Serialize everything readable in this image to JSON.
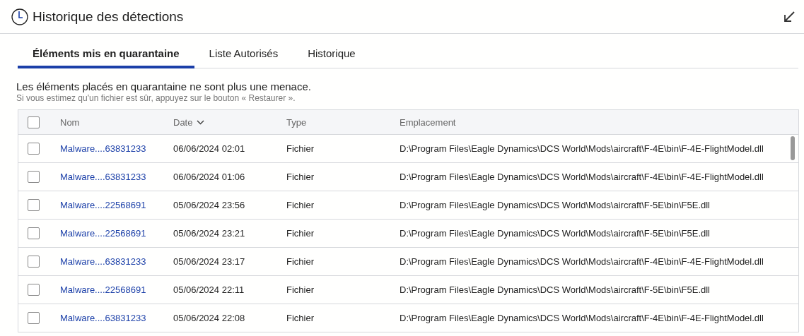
{
  "window": {
    "title": "Historique des détections"
  },
  "tabs": [
    {
      "label": "Éléments mis en quarantaine",
      "selected": true
    },
    {
      "label": "Liste Autorisés",
      "selected": false
    },
    {
      "label": "Historique",
      "selected": false
    }
  ],
  "description": "Les éléments placés en quarantaine ne sont plus une menace.",
  "hint": "Si vous estimez qu'un fichier est sûr, appuyez sur le bouton « Restaurer ».",
  "table": {
    "select_all_checked": false,
    "columns": [
      "Nom",
      "Date",
      "Type",
      "Emplacement"
    ],
    "rows": [
      {
        "checked": false,
        "name": "Malware....63831233",
        "date": "06/06/2024 02:01",
        "type": "Fichier",
        "location": "D:\\Program Files\\Eagle Dynamics\\DCS World\\Mods\\aircraft\\F-4E\\bin\\F-4E-FlightModel.dll"
      },
      {
        "checked": false,
        "name": "Malware....63831233",
        "date": "06/06/2024 01:06",
        "type": "Fichier",
        "location": "D:\\Program Files\\Eagle Dynamics\\DCS World\\Mods\\aircraft\\F-4E\\bin\\F-4E-FlightModel.dll"
      },
      {
        "checked": false,
        "name": "Malware....22568691",
        "date": "05/06/2024 23:56",
        "type": "Fichier",
        "location": "D:\\Program Files\\Eagle Dynamics\\DCS World\\Mods\\aircraft\\F-5E\\bin\\F5E.dll"
      },
      {
        "checked": false,
        "name": "Malware....22568691",
        "date": "05/06/2024 23:21",
        "type": "Fichier",
        "location": "D:\\Program Files\\Eagle Dynamics\\DCS World\\Mods\\aircraft\\F-5E\\bin\\F5E.dll"
      },
      {
        "checked": false,
        "name": "Malware....63831233",
        "date": "05/06/2024 23:17",
        "type": "Fichier",
        "location": "D:\\Program Files\\Eagle Dynamics\\DCS World\\Mods\\aircraft\\F-4E\\bin\\F-4E-FlightModel.dll"
      },
      {
        "checked": false,
        "name": "Malware....22568691",
        "date": "05/06/2024 22:11",
        "type": "Fichier",
        "location": "D:\\Program Files\\Eagle Dynamics\\DCS World\\Mods\\aircraft\\F-5E\\bin\\F5E.dll"
      },
      {
        "checked": false,
        "name": "Malware....63831233",
        "date": "05/06/2024 22:08",
        "type": "Fichier",
        "location": "D:\\Program Files\\Eagle Dynamics\\DCS World\\Mods\\aircraft\\F-4E\\bin\\F-4E-FlightModel.dll"
      }
    ]
  }
}
